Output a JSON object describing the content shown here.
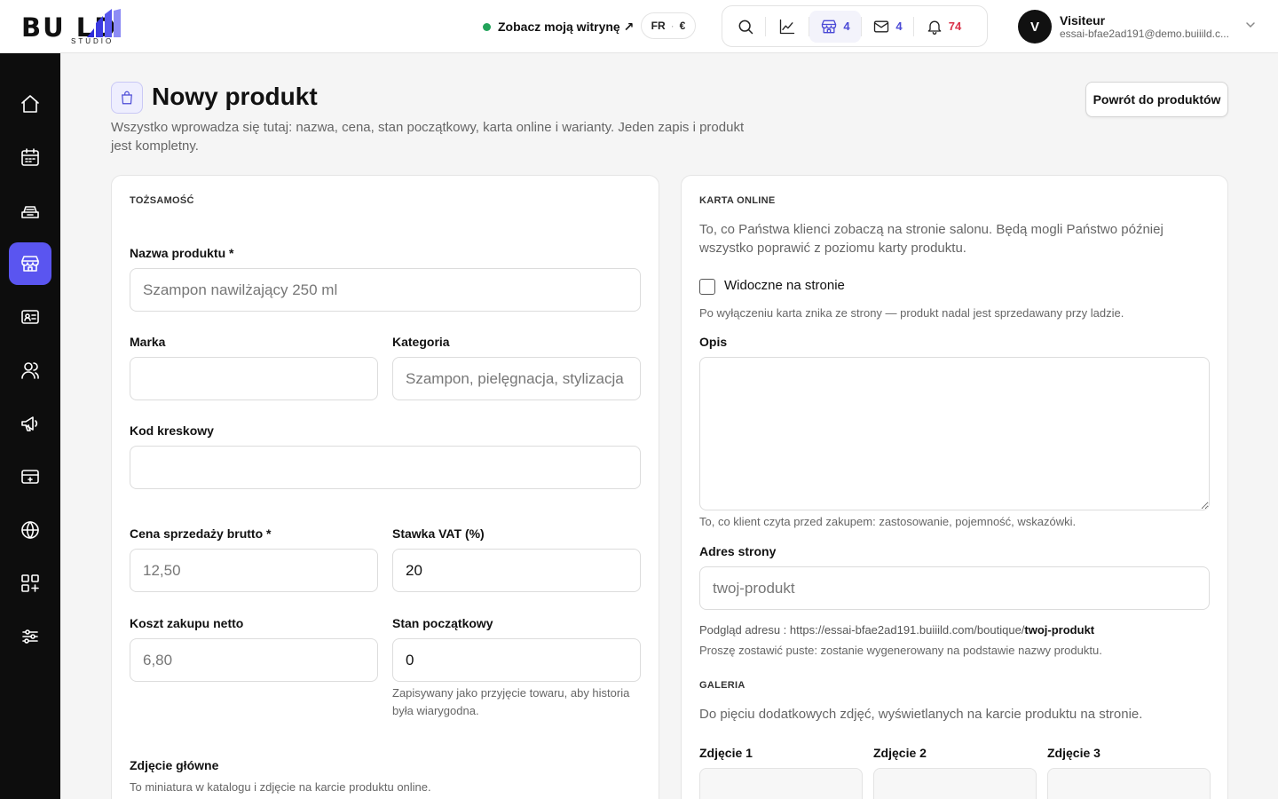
{
  "brand": {
    "logo_word": "BU  LD",
    "logo_sub": "STUDIO"
  },
  "topbar": {
    "site_link": "Zobacz moją witrynę ↗",
    "lang": "FR",
    "currency": "€",
    "shop_count": "4",
    "mail_count": "4",
    "notif_count": "74",
    "user_initial": "V",
    "user_name": "Visiteur",
    "user_email": "essai-bfae2ad191@demo.buiiild.c..."
  },
  "colors": {
    "accent": "#5a55f0",
    "online_dot": "#22a35a",
    "notif": "#d9334a"
  },
  "sidebar": {
    "items": [
      {
        "name": "home-icon",
        "active": false
      },
      {
        "name": "calendar-icon",
        "active": false
      },
      {
        "name": "cash-register-icon",
        "active": false
      },
      {
        "name": "shop-icon",
        "active": true
      },
      {
        "name": "contact-card-icon",
        "active": false
      },
      {
        "name": "users-icon",
        "active": false
      },
      {
        "name": "megaphone-icon",
        "active": false
      },
      {
        "name": "payment-card-icon",
        "active": false
      },
      {
        "name": "globe-icon",
        "active": false
      },
      {
        "name": "apps-add-icon",
        "active": false
      },
      {
        "name": "sliders-icon",
        "active": false
      }
    ]
  },
  "page": {
    "title": "Nowy produkt",
    "subtitle": "Wszystko wprowadza się tutaj: nazwa, cena, stan początkowy, karta online i warianty. Jeden zapis i produkt jest kompletny.",
    "back_button": "Powrót do produktów"
  },
  "identity": {
    "section": "TOŻSAMOŚĆ",
    "name_label": "Nazwa produktu *",
    "name_placeholder": "Szampon nawilżający 250 ml",
    "brand_label": "Marka",
    "category_label": "Kategoria",
    "category_placeholder": "Szampon, pielęgnacja, stylizacja",
    "barcode_label": "Kod kreskowy",
    "price_label": "Cena sprzedaży brutto *",
    "price_placeholder": "12,50",
    "vat_label": "Stawka VAT (%)",
    "vat_value": "20",
    "cost_label": "Koszt zakupu netto",
    "cost_placeholder": "6,80",
    "stock_label": "Stan początkowy",
    "stock_value": "0",
    "stock_hint": "Zapisywany jako przyjęcie towaru, aby historia była wiarygodna.",
    "main_photo_label": "Zdjęcie główne",
    "main_photo_hint": "To miniatura w katalogu i zdjęcie na karcie produktu online."
  },
  "online": {
    "section": "KARTA ONLINE",
    "intro": "To, co Państwa klienci zobaczą na stronie salonu. Będą mogli Państwo później wszystko poprawić z poziomu karty produktu.",
    "visible_label": "Widoczne na stronie",
    "visible_checked": false,
    "visible_hint": "Po wyłączeniu karta znika ze strony — produkt nadal jest sprzedawany przy ladzie.",
    "description_label": "Opis",
    "description_hint": "To, co klient czyta przed zakupem: zastosowanie, pojemność, wskazówki.",
    "url_label": "Adres strony",
    "url_placeholder": "twoj-produkt",
    "url_preview_prefix": "Podgląd adresu : https://essai-bfae2ad191.buiiild.com/boutique/",
    "url_preview_slug": "twoj-produkt",
    "url_hint": "Proszę zostawić puste: zostanie wygenerowany na podstawie nazwy produktu.",
    "gallery_section": "GALERIA",
    "gallery_intro": "Do pięciu dodatkowych zdjęć, wyświetlanych na karcie produktu na stronie.",
    "photos": [
      "Zdjęcie 1",
      "Zdjęcie 2",
      "Zdjęcie 3"
    ]
  }
}
